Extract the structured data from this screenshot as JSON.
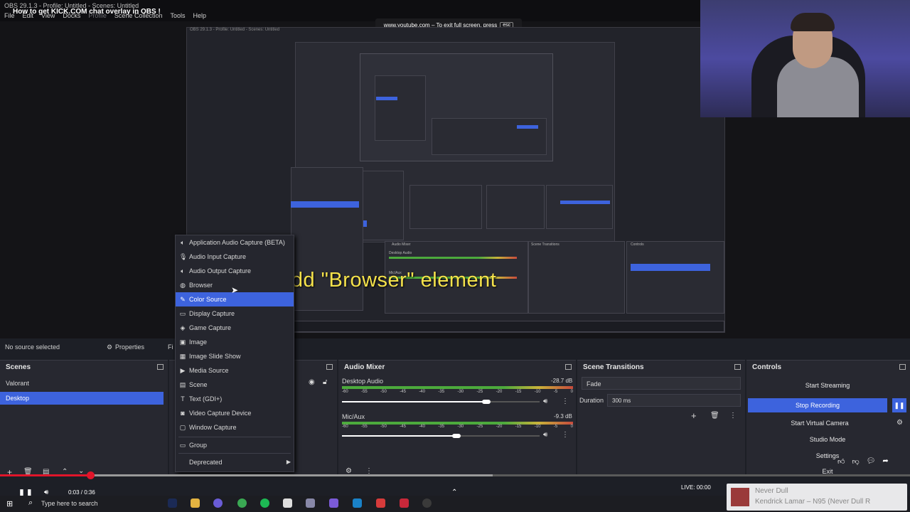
{
  "window": {
    "obs_title": "OBS 29.1.3 - Profile: Untitled - Scenes: Untitled",
    "video_title": "How to get KICK.COM chat overlay in OBS !",
    "menu": [
      "File",
      "Edit",
      "View",
      "Docks",
      "Profile",
      "Scene Collection",
      "Tools",
      "Help"
    ]
  },
  "fullscreen_notice": {
    "text": "www.youtube.com – To exit full screen, press",
    "key": "esc"
  },
  "overlay_caption": "Add \"Browser\" element",
  "source_row": {
    "status": "No source selected",
    "properties": "Properties",
    "filters": "Fi"
  },
  "context_menu": {
    "items": [
      {
        "label": "Application Audio Capture (BETA)",
        "icon": "speaker-icon"
      },
      {
        "label": "Audio Input Capture",
        "icon": "microphone-icon"
      },
      {
        "label": "Audio Output Capture",
        "icon": "speaker-icon"
      },
      {
        "label": "Browser",
        "icon": "globe-icon"
      },
      {
        "label": "Color Source",
        "icon": "brush-icon",
        "selected": true
      },
      {
        "label": "Display Capture",
        "icon": "monitor-icon"
      },
      {
        "label": "Game Capture",
        "icon": "gamepad-icon"
      },
      {
        "label": "Image",
        "icon": "image-icon"
      },
      {
        "label": "Image Slide Show",
        "icon": "slideshow-icon"
      },
      {
        "label": "Media Source",
        "icon": "play-icon"
      },
      {
        "label": "Scene",
        "icon": "scene-icon"
      },
      {
        "label": "Text (GDI+)",
        "icon": "text-icon"
      },
      {
        "label": "Video Capture Device",
        "icon": "camera-icon"
      },
      {
        "label": "Window Capture",
        "icon": "window-icon"
      },
      {
        "label": "Group",
        "icon": "folder-icon"
      },
      {
        "label": "Deprecated",
        "icon": ""
      }
    ]
  },
  "scenes": {
    "title": "Scenes",
    "items": [
      "Valorant",
      "Desktop"
    ],
    "selected": "Desktop"
  },
  "audio_mixer": {
    "title": "Audio Mixer",
    "channels": [
      {
        "name": "Desktop Audio",
        "db": "-28.7 dB",
        "level": 0.73
      },
      {
        "name": "Mic/Aux",
        "db": "-9.3 dB",
        "level": 0.58
      }
    ],
    "scale": [
      "-60",
      "-55",
      "-50",
      "-45",
      "-40",
      "-35",
      "-30",
      "-25",
      "-20",
      "-15",
      "-10",
      "-5",
      "0"
    ]
  },
  "scene_transitions": {
    "title": "Scene Transitions",
    "transition": "Fade",
    "duration_label": "Duration",
    "duration_value": "300 ms"
  },
  "controls": {
    "title": "Controls",
    "buttons": [
      "Start Streaming",
      "Stop Recording",
      "Start Virtual Camera",
      "Studio Mode",
      "Settings",
      "Exit"
    ]
  },
  "player": {
    "time": "0:03 / 0:36",
    "search_placeholder": "Type here to search",
    "live": "LIVE: 00:00"
  },
  "now_playing": {
    "song": "Never Dull",
    "artist": "Kendrick Lamar – N95 (Never Dull R"
  },
  "colors": {
    "accent": "#3d63dd",
    "caption": "#f5e24b",
    "progress": "#e0152a"
  }
}
